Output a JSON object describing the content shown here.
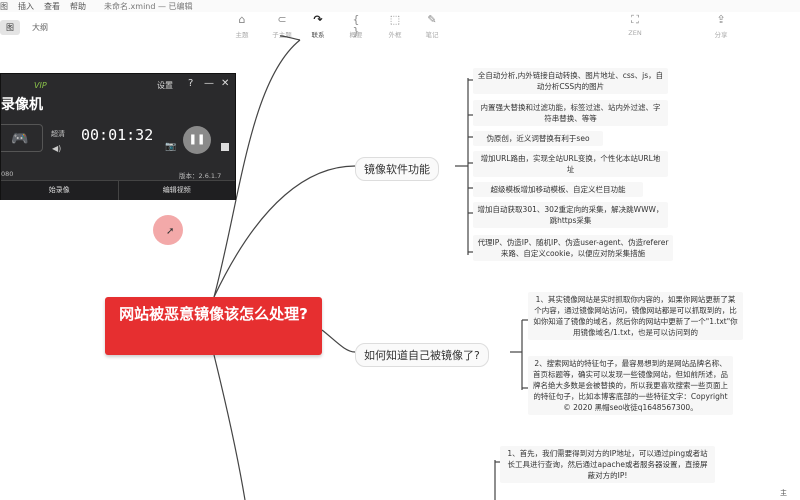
{
  "menubar": {
    "items": [
      "图",
      "插入",
      "查看",
      "帮助"
    ],
    "file_status": "未命名.xmind — 已编辑"
  },
  "view_tabs": [
    "图",
    "大纲"
  ],
  "toolbar": {
    "tools": [
      {
        "label": "主题",
        "icon": "⌂"
      },
      {
        "label": "子主题",
        "icon": "⊂"
      },
      {
        "label": "联系",
        "icon": "↷"
      },
      {
        "label": "概要",
        "icon": "{ }"
      },
      {
        "label": "外框",
        "icon": "⬚"
      },
      {
        "label": "笔记",
        "icon": "✎"
      }
    ],
    "zen_label": "ZEN",
    "share_label": "分享"
  },
  "recorder": {
    "vip": "VIP",
    "settings": "设置",
    "help": "?",
    "minimize": "—",
    "close": "✕",
    "title": "录像机",
    "quality": "超清",
    "timer": "00:01:32",
    "resolution": "080",
    "version": "版本：2.6.1.7",
    "record_button": "始录像",
    "edit_button": "编辑视频"
  },
  "mindmap": {
    "central": "网站被恶意镜像该怎么处理?",
    "branch1": {
      "label": "镜像软件功能",
      "leaves": [
        "全自动分析,内外链接自动转换、图片地址、css、js，自动分析CSS内的图片",
        "内置强大替换和过滤功能，标签过滤、站内外过滤、字符串替换、等等",
        "伪原创，近义词替换有利于seo",
        "增加URL路由，实现全站URL变换，个性化本站URL地址",
        "超级模板增加移动模板、自定义栏目功能",
        "增加自动获取301、302重定向的采集，解决跳WWW，跳https采集",
        "代理IP、伪造IP、随机IP、伪造user-agent、伪造referer来路、自定义cookie，以便应对防采集措施"
      ]
    },
    "branch2": {
      "label": "如何知道自己被镜像了?",
      "leaves": [
        "1、其实镜像网站是实时抓取你内容的，如果你网站更新了某个内容，通过镜像网站访问，镜像网站都是可以抓取到的，比如你知道了镜像的域名，然后你的网站中更新了一个\"1.txt\"你用镜像域名/1.txt，也是可以访问到的",
        "2、搜索网站的特征句子，最容易想到的是网站品牌名称、首页标题等，确实可以发现一些镜像网站，但如前所述，品牌名绝大多数是会被替换的，所以我更喜欢搜索一些页面上的特征句子，比如本博客底部的一些特征文字：Copyright © 2020 黑帽seo收徒q1648567300。"
      ]
    },
    "branch3": {
      "leaves": [
        "1、首先，我们需要得到对方的IP地址，可以通过ping或者站长工具进行查询，然后通过apache或者服务器设置，直接屏蔽对方的IP!"
      ]
    }
  },
  "status_text": "主"
}
